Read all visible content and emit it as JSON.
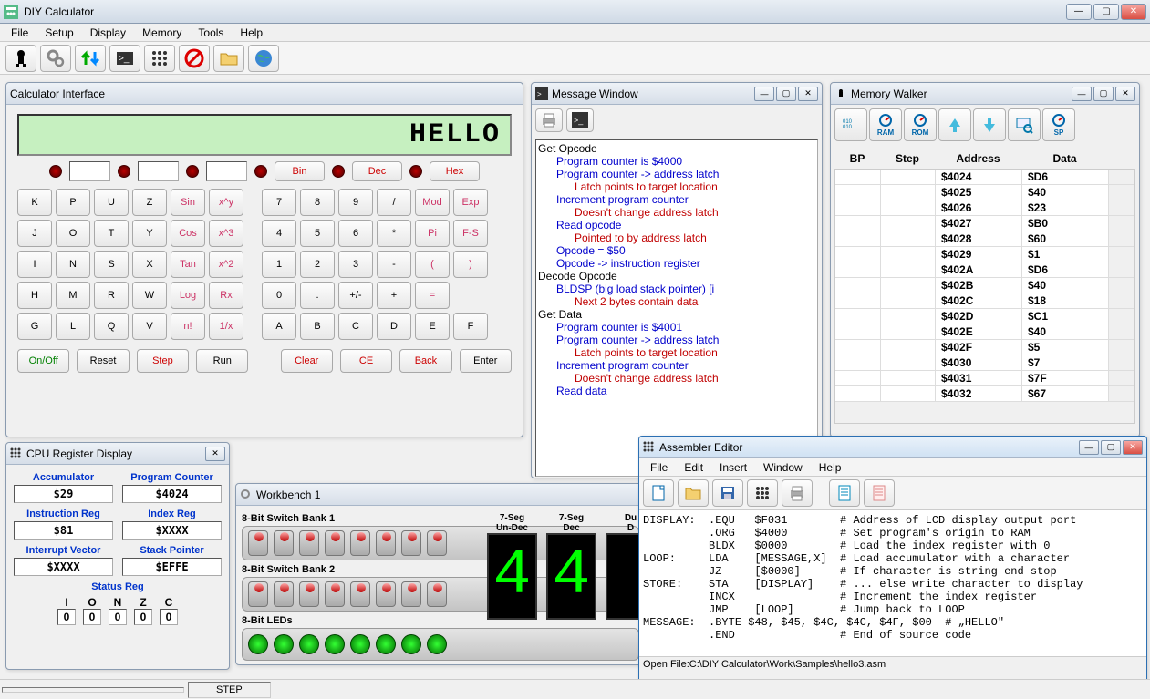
{
  "window": {
    "title": "DIY Calculator"
  },
  "menubar": [
    "File",
    "Setup",
    "Display",
    "Memory",
    "Tools",
    "Help"
  ],
  "calc": {
    "title": "Calculator Interface",
    "lcd": "HELLO",
    "modes": [
      "Bin",
      "Dec",
      "Hex"
    ],
    "left_keys": [
      [
        "K",
        "P",
        "U",
        "Z",
        "Sin",
        "x^y"
      ],
      [
        "J",
        "O",
        "T",
        "Y",
        "Cos",
        "x^3"
      ],
      [
        "I",
        "N",
        "S",
        "X",
        "Tan",
        "x^2"
      ],
      [
        "H",
        "M",
        "R",
        "W",
        "Log",
        "Rx"
      ],
      [
        "G",
        "L",
        "Q",
        "V",
        "n!",
        "1/x"
      ]
    ],
    "right_keys": [
      [
        "7",
        "8",
        "9",
        "/",
        "Mod",
        "Exp"
      ],
      [
        "4",
        "5",
        "6",
        "*",
        "Pi",
        "F-S"
      ],
      [
        "1",
        "2",
        "3",
        "-",
        "(",
        ")"
      ],
      [
        "0",
        ".",
        "+/-",
        "+",
        "=",
        ""
      ],
      [
        "A",
        "B",
        "C",
        "D",
        "E",
        "F"
      ]
    ],
    "ctrl_left": [
      "On/Off",
      "Reset",
      "Step",
      "Run"
    ],
    "ctrl_right": [
      "Clear",
      "CE",
      "Back",
      "Enter"
    ]
  },
  "msg": {
    "title": "Message Window",
    "lines": [
      {
        "lvl": 0,
        "t": "Get Opcode"
      },
      {
        "lvl": 1,
        "t": "Program counter is $4000"
      },
      {
        "lvl": 1,
        "t": "Program counter -> address latch"
      },
      {
        "lvl": 2,
        "t": "Latch points to target location"
      },
      {
        "lvl": 1,
        "t": "Increment program counter"
      },
      {
        "lvl": 2,
        "t": "Doesn't change address latch"
      },
      {
        "lvl": 1,
        "t": "Read opcode"
      },
      {
        "lvl": 2,
        "t": "Pointed to by address latch"
      },
      {
        "lvl": 1,
        "t": "Opcode = $50"
      },
      {
        "lvl": 1,
        "t": "Opcode -> instruction register"
      },
      {
        "lvl": 0,
        "t": "Decode Opcode"
      },
      {
        "lvl": 1,
        "t": "BLDSP (big load stack pointer) [i"
      },
      {
        "lvl": 2,
        "t": "Next 2 bytes contain data"
      },
      {
        "lvl": 0,
        "t": "Get Data"
      },
      {
        "lvl": 1,
        "t": "Program counter is $4001"
      },
      {
        "lvl": 1,
        "t": "Program counter -> address latch"
      },
      {
        "lvl": 2,
        "t": "Latch points to target location"
      },
      {
        "lvl": 1,
        "t": "Increment program counter"
      },
      {
        "lvl": 2,
        "t": "Doesn't change address latch"
      },
      {
        "lvl": 1,
        "t": "Read data"
      }
    ]
  },
  "memw": {
    "title": "Memory Walker",
    "cols": [
      "BP",
      "Step",
      "Address",
      "Data"
    ],
    "rows": [
      {
        "addr": "$4024",
        "data": "$D6"
      },
      {
        "addr": "$4025",
        "data": "$40"
      },
      {
        "addr": "$4026",
        "data": "$23"
      },
      {
        "addr": "$4027",
        "data": "$B0"
      },
      {
        "addr": "$4028",
        "data": "$60"
      },
      {
        "addr": "$4029",
        "data": "$1"
      },
      {
        "addr": "$402A",
        "data": "$D6"
      },
      {
        "addr": "$402B",
        "data": "$40"
      },
      {
        "addr": "$402C",
        "data": "$18"
      },
      {
        "addr": "$402D",
        "data": "$C1"
      },
      {
        "addr": "$402E",
        "data": "$40"
      },
      {
        "addr": "$402F",
        "data": "$5"
      },
      {
        "addr": "$4030",
        "data": "$7"
      },
      {
        "addr": "$4031",
        "data": "$7F"
      },
      {
        "addr": "$4032",
        "data": "$67"
      }
    ]
  },
  "cpu": {
    "title": "CPU Register Display",
    "regs": {
      "Accumulator": "$29",
      "Program Counter": "$4024",
      "Instruction Reg": "$81",
      "Index Reg": "$XXXX",
      "Interrupt Vector": "$XXXX",
      "Stack Pointer": "$EFFE"
    },
    "status_label": "Status Reg",
    "flags": {
      "I": "0",
      "O": "0",
      "N": "0",
      "Z": "0",
      "C": "0"
    }
  },
  "wb": {
    "title": "Workbench 1",
    "bank1": "8-Bit Switch Bank 1",
    "bank2": "8-Bit Switch Bank 2",
    "leds": "8-Bit LEDs",
    "seven": [
      {
        "label1": "7-Seg",
        "label2": "Un-Dec",
        "val": "4"
      },
      {
        "label1": "7-Seg",
        "label2": "Dec",
        "val": "4"
      },
      {
        "label1": "Du",
        "label2": "D",
        "val": ""
      }
    ]
  },
  "asm": {
    "title": "Assembler Editor",
    "menus": [
      "File",
      "Edit",
      "Insert",
      "Window",
      "Help"
    ],
    "code": "DISPLAY:  .EQU   $F031        # Address of LCD display output port\n          .ORG   $4000        # Set program's origin to RAM\n          BLDX   $0000        # Load the index register with 0\nLOOP:     LDA    [MESSAGE,X]  # Load accumulator with a character\n          JZ     [$0000]      # If character is string end stop\nSTORE:    STA    [DISPLAY]    # ... else write character to display\n          INCX                # Increment the index register\n          JMP    [LOOP]       # Jump back to LOOP\nMESSAGE:  .BYTE $48, $45, $4C, $4C, $4F, $00  # „HELLO\"\n          .END                # End of source code",
    "status": "Open File:C:\\DIY Calculator\\Work\\Samples\\hello3.asm"
  },
  "appstatus": {
    "step": "STEP"
  }
}
